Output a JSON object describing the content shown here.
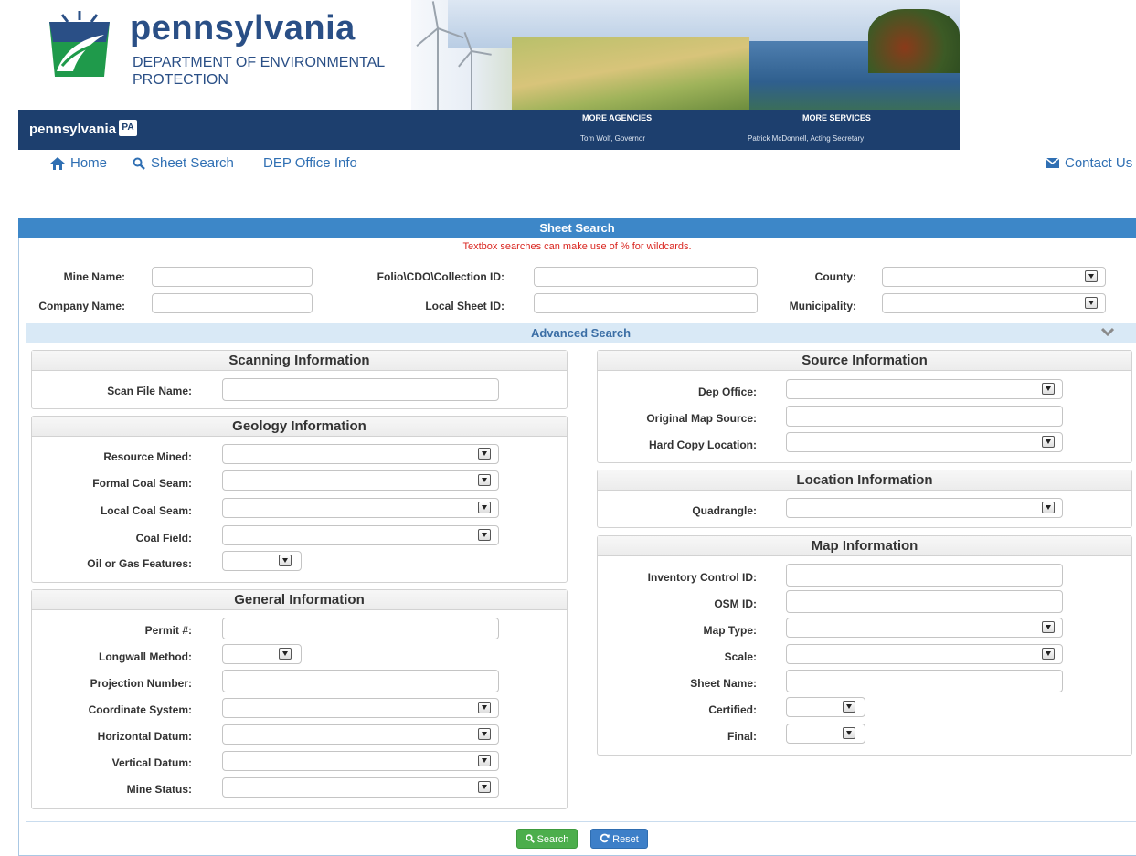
{
  "header": {
    "logo_title": "pennsylvania",
    "logo_subtitle_line1": "DEPARTMENT OF ENVIRONMENTAL",
    "logo_subtitle_line2": "PROTECTION",
    "gov_pa_text": "pennsylvania",
    "gov_pa_badge": "PA",
    "more_agencies": "MORE AGENCIES",
    "more_services": "MORE SERVICES",
    "governor": "Tom Wolf, Governor",
    "secretary": "Patrick McDonnell, Acting Secretary"
  },
  "nav": {
    "home": "Home",
    "sheet_search": "Sheet Search",
    "dep_office_info": "DEP Office Info",
    "contact_us": "Contact Us"
  },
  "panel": {
    "title": "Sheet Search",
    "wildcard_note": "Textbox searches can make use of % for wildcards.",
    "mine_name": "Mine Name:",
    "company_name": "Company Name:",
    "folio_id": "Folio\\CDO\\Collection ID:",
    "local_sheet_id": "Local Sheet ID:",
    "county": "County:",
    "municipality": "Municipality:",
    "advanced_search": "Advanced Search"
  },
  "scanning": {
    "title": "Scanning Information",
    "scan_file_name": "Scan File Name:"
  },
  "geology": {
    "title": "Geology Information",
    "resource_mined": "Resource Mined:",
    "formal_coal_seam": "Formal Coal Seam:",
    "local_coal_seam": "Local Coal Seam:",
    "coal_field": "Coal Field:",
    "oil_gas": "Oil or Gas Features:"
  },
  "general": {
    "title": "General Information",
    "permit": "Permit #:",
    "longwall": "Longwall Method:",
    "projection": "Projection Number:",
    "coord_system": "Coordinate System:",
    "horiz_datum": "Horizontal Datum:",
    "vert_datum": "Vertical Datum:",
    "mine_status": "Mine Status:"
  },
  "source": {
    "title": "Source Information",
    "dep_office": "Dep Office:",
    "orig_map_source": "Original Map Source:",
    "hard_copy": "Hard Copy Location:"
  },
  "location": {
    "title": "Location Information",
    "quadrangle": "Quadrangle:"
  },
  "map": {
    "title": "Map Information",
    "inventory_id": "Inventory Control ID:",
    "osm_id": "OSM ID:",
    "map_type": "Map Type:",
    "scale": "Scale:",
    "sheet_name": "Sheet Name:",
    "certified": "Certified:",
    "final": "Final:"
  },
  "buttons": {
    "search": "Search",
    "reset": "Reset"
  },
  "colors": {
    "brand_blue": "#2a4f86",
    "panel_header": "#3d87c8",
    "link_blue": "#2f6fb3",
    "note_red": "#d9251f",
    "search_green": "#4cae4c"
  }
}
